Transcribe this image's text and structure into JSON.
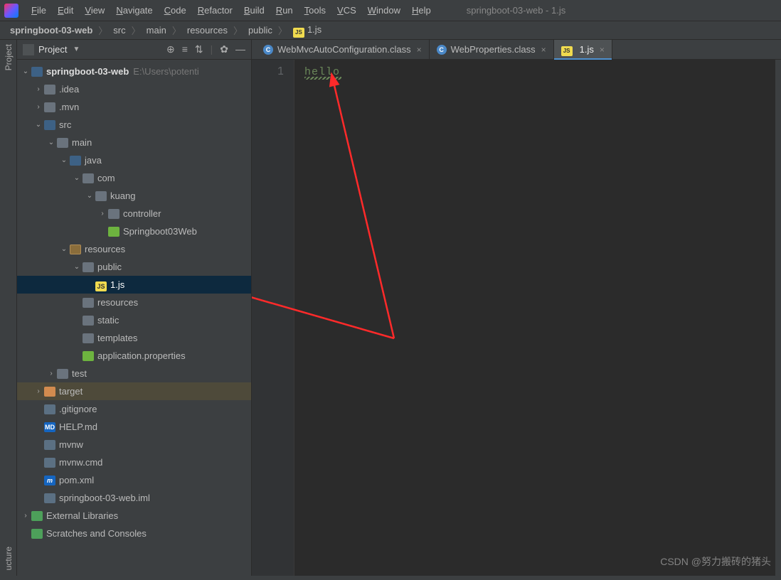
{
  "window_title": "springboot-03-web - 1.js",
  "menu": [
    "File",
    "Edit",
    "View",
    "Navigate",
    "Code",
    "Refactor",
    "Build",
    "Run",
    "Tools",
    "VCS",
    "Window",
    "Help"
  ],
  "breadcrumbs": [
    "springboot-03-web",
    "src",
    "main",
    "resources",
    "public",
    "1.js"
  ],
  "project_panel": {
    "title": "Project"
  },
  "side_gutter": {
    "top": "Project",
    "bottom": "ucture"
  },
  "tree": {
    "root": {
      "label": "springboot-03-web",
      "path": "E:\\Users\\potenti"
    },
    "nodes": [
      {
        "indent": 1,
        "arrow": ">",
        "icon": "folder",
        "label": ".idea"
      },
      {
        "indent": 1,
        "arrow": ">",
        "icon": "folder",
        "label": ".mvn"
      },
      {
        "indent": 1,
        "arrow": "v",
        "icon": "folder-src",
        "label": "src"
      },
      {
        "indent": 2,
        "arrow": "v",
        "icon": "folder",
        "label": "main"
      },
      {
        "indent": 3,
        "arrow": "v",
        "icon": "folder-src",
        "label": "java"
      },
      {
        "indent": 4,
        "arrow": "v",
        "icon": "folder",
        "label": "com"
      },
      {
        "indent": 5,
        "arrow": "v",
        "icon": "folder",
        "label": "kuang"
      },
      {
        "indent": 6,
        "arrow": ">",
        "icon": "folder",
        "label": "controller"
      },
      {
        "indent": 6,
        "arrow": "",
        "icon": "spring",
        "label": "Springboot03Web"
      },
      {
        "indent": 3,
        "arrow": "v",
        "icon": "folder-res",
        "label": "resources"
      },
      {
        "indent": 4,
        "arrow": "v",
        "icon": "folder",
        "label": "public"
      },
      {
        "indent": 5,
        "arrow": "",
        "icon": "js",
        "label": "1.js",
        "selected": true
      },
      {
        "indent": 4,
        "arrow": "",
        "icon": "folder",
        "label": "resources"
      },
      {
        "indent": 4,
        "arrow": "",
        "icon": "folder",
        "label": "static"
      },
      {
        "indent": 4,
        "arrow": "",
        "icon": "folder",
        "label": "templates"
      },
      {
        "indent": 4,
        "arrow": "",
        "icon": "spring",
        "label": "application.properties"
      },
      {
        "indent": 2,
        "arrow": ">",
        "icon": "folder",
        "label": "test"
      },
      {
        "indent": 1,
        "arrow": ">",
        "icon": "folder-o",
        "label": "target",
        "hl": true
      },
      {
        "indent": 1,
        "arrow": "",
        "icon": "file",
        "label": ".gitignore"
      },
      {
        "indent": 1,
        "arrow": "",
        "icon": "md",
        "label": "HELP.md"
      },
      {
        "indent": 1,
        "arrow": "",
        "icon": "file",
        "label": "mvnw"
      },
      {
        "indent": 1,
        "arrow": "",
        "icon": "file",
        "label": "mvnw.cmd"
      },
      {
        "indent": 1,
        "arrow": "",
        "icon": "m",
        "label": "pom.xml"
      },
      {
        "indent": 1,
        "arrow": "",
        "icon": "file",
        "label": "springboot-03-web.iml"
      }
    ],
    "ext1": "External Libraries",
    "ext2": "Scratches and Consoles"
  },
  "tabs": [
    {
      "icon": "class",
      "label": "WebMvcAutoConfiguration.class"
    },
    {
      "icon": "class",
      "label": "WebProperties.class"
    },
    {
      "icon": "js",
      "label": "1.js",
      "active": true
    }
  ],
  "editor": {
    "line_no": "1",
    "content": "hello"
  },
  "watermark": "CSDN @努力搬砖的猪头"
}
